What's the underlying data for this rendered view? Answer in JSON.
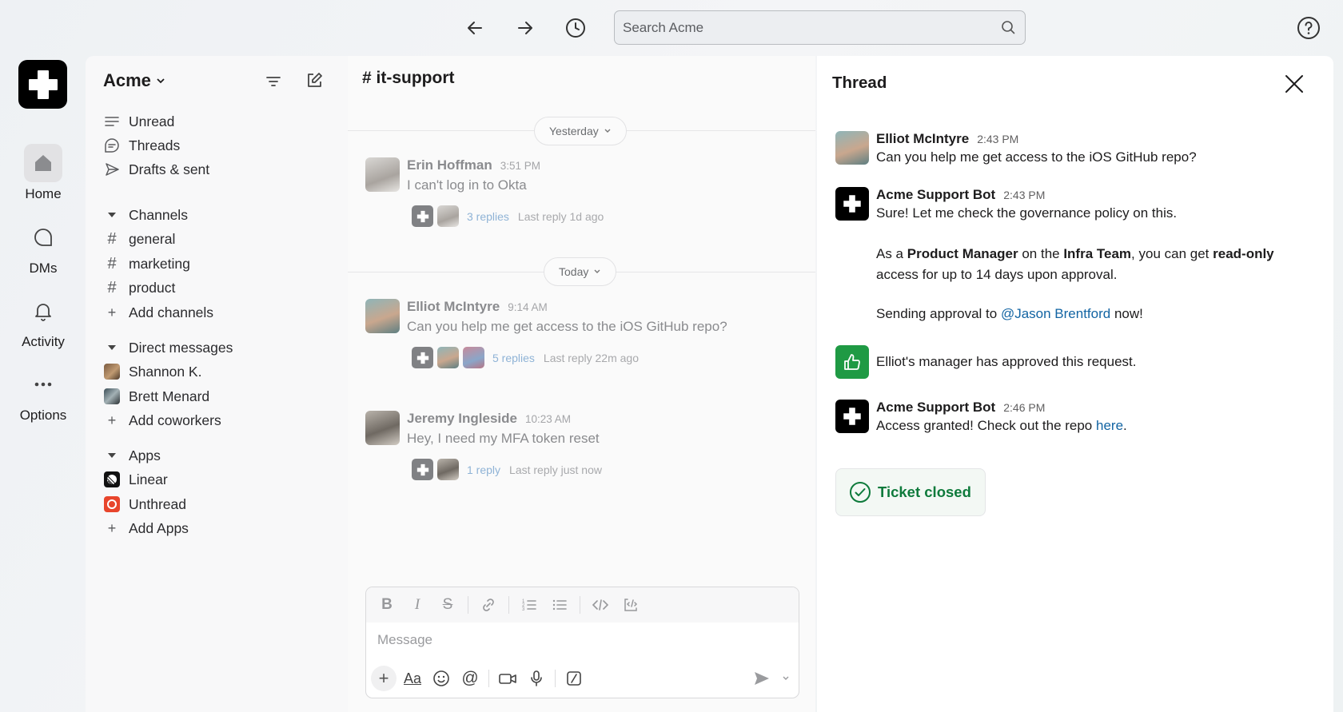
{
  "topbar": {
    "search_placeholder": "Search Acme"
  },
  "rail": {
    "items": [
      {
        "label": "Home",
        "icon": "home-icon"
      },
      {
        "label": "DMs",
        "icon": "dm-icon"
      },
      {
        "label": "Activity",
        "icon": "bell-icon"
      },
      {
        "label": "Options",
        "icon": "more-icon"
      }
    ]
  },
  "sidebar": {
    "workspace": "Acme",
    "nav": [
      {
        "label": "Unread",
        "icon": "unread-icon"
      },
      {
        "label": "Threads",
        "icon": "threads-icon"
      },
      {
        "label": "Drafts & sent",
        "icon": "send-icon"
      }
    ],
    "channels_header": "Channels",
    "channels": [
      "general",
      "marketing",
      "product"
    ],
    "add_channels": "Add channels",
    "dm_header": "Direct messages",
    "dms": [
      "Shannon K.",
      "Brett Menard"
    ],
    "add_coworkers": "Add coworkers",
    "apps_header": "Apps",
    "apps": [
      {
        "label": "Linear",
        "color": "#111111"
      },
      {
        "label": "Unthread",
        "color": "#e8452c"
      }
    ],
    "add_apps": "Add Apps"
  },
  "channel": {
    "name": "it-support",
    "yesterday": "Yesterday",
    "today": "Today",
    "messages": [
      {
        "author": "Erin Hoffman",
        "time": "3:51 PM",
        "text": "I can't log in to Okta",
        "reply_count": "3 replies",
        "last_reply": "Last reply 1d ago"
      },
      {
        "author": "Elliot McIntyre",
        "time": "9:14 AM",
        "text": "Can you help me get access to the iOS GitHub repo?",
        "reply_count": "5 replies",
        "last_reply": "Last reply 22m ago"
      },
      {
        "author": "Jeremy Ingleside",
        "time": "10:23 AM",
        "text": "Hey, I need my MFA token reset",
        "reply_count": "1 reply",
        "last_reply": "Last reply just now"
      }
    ],
    "composer_placeholder": "Message"
  },
  "thread": {
    "title": "Thread",
    "m1": {
      "author": "Elliot McIntyre",
      "time": "2:43 PM",
      "text": "Can you help me get access to the iOS GitHub repo?"
    },
    "m2": {
      "author": "Acme Support Bot",
      "time": "2:43 PM",
      "line1": "Sure! Let me check the governance policy on this.",
      "p_as_a": "As a ",
      "p_role": "Product Manager",
      "p_on_the": " on the ",
      "p_team": "Infra Team",
      "p_can_get": ", you can get ",
      "p_access": "read-only",
      "line3": "access for up to 14 days upon approval.",
      "send_prefix": "Sending approval to ",
      "send_mention": "@Jason Brentford",
      "send_suffix": " now!"
    },
    "approval": "Elliot's manager has approved this request.",
    "m3": {
      "author": "Acme Support Bot",
      "time": "2:46 PM",
      "prefix": "Access granted! Check out the repo ",
      "link": "here",
      "suffix": "."
    },
    "ticket": "Ticket closed"
  },
  "colors": {
    "accent_link": "#1264a3",
    "success": "#0e7a3b",
    "approval_bg": "#1f9a44"
  }
}
